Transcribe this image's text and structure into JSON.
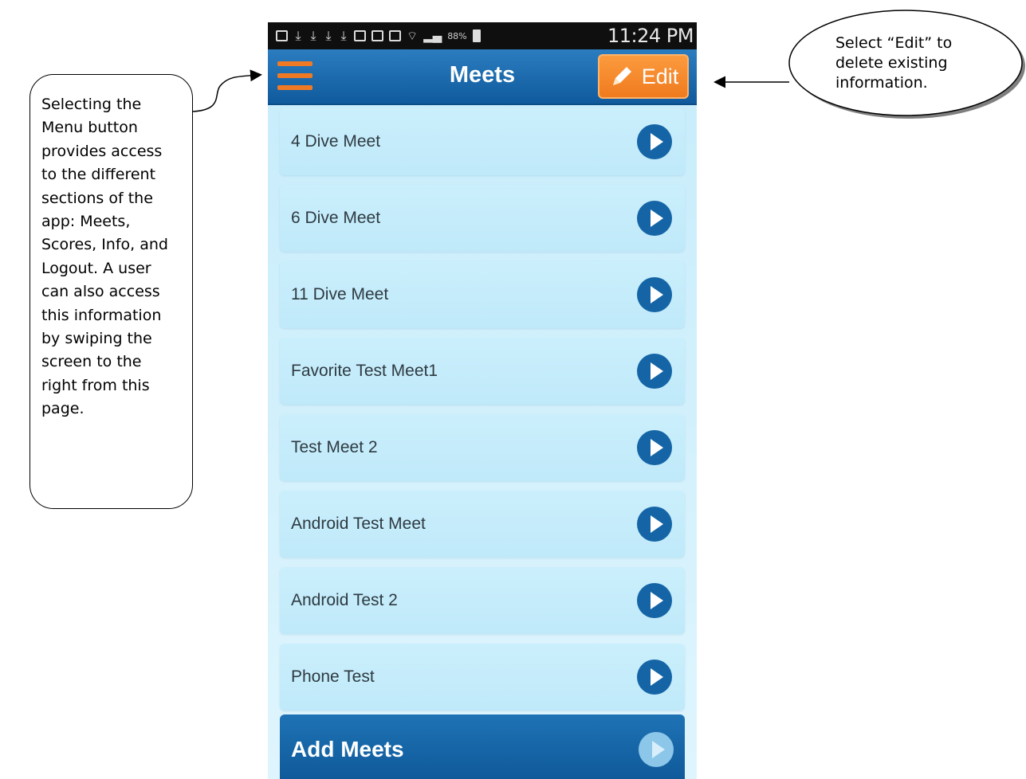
{
  "status_bar": {
    "battery": "88%",
    "time": "11:24 PM"
  },
  "header": {
    "menu_icon": "hamburger-menu-icon",
    "title": "Meets",
    "edit_label": "Edit",
    "edit_icon": "pencil-icon"
  },
  "meets": [
    {
      "label": "4 Dive Meet"
    },
    {
      "label": "6 Dive Meet"
    },
    {
      "label": "11 Dive Meet"
    },
    {
      "label": "Favorite Test Meet1"
    },
    {
      "label": "Test Meet 2"
    },
    {
      "label": "Android Test Meet"
    },
    {
      "label": "Android Test 2"
    },
    {
      "label": "Phone Test"
    }
  ],
  "add_meets_label": "Add Meets",
  "callouts": {
    "menu": "Selecting the\nMenu button\nprovides access\nto the different\nsections of the\napp:  Meets,\nScores, Info, and\nLogout.  A user\ncan also access\nthis information\nby swiping the\nscreen to the\nright from this\npage.",
    "edit": "Select “Edit” to\ndelete existing\ninformation."
  },
  "colors": {
    "header_blue": "#1565a6",
    "accent_orange": "#f07a24",
    "row_background": "#c7ecfb"
  }
}
